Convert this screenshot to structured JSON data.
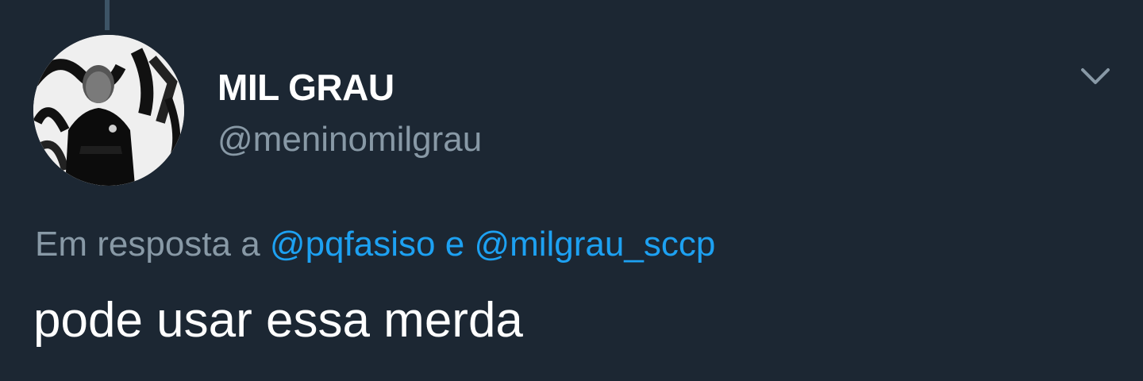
{
  "tweet": {
    "display_name": "MIL GRAU",
    "handle": "@meninomilgrau",
    "reply_prefix": "Em resposta a",
    "reply_mentions": [
      "@pqfasiso",
      "@milgrau_sccp"
    ],
    "reply_joiner": "e",
    "text": "pode usar essa merda"
  },
  "icons": {
    "menu": "chevron-down-icon",
    "avatar": "profile-photo"
  },
  "colors": {
    "background": "#1c2733",
    "secondary_text": "#8899a6",
    "link": "#1da1f2",
    "primary_text": "#ffffff"
  }
}
